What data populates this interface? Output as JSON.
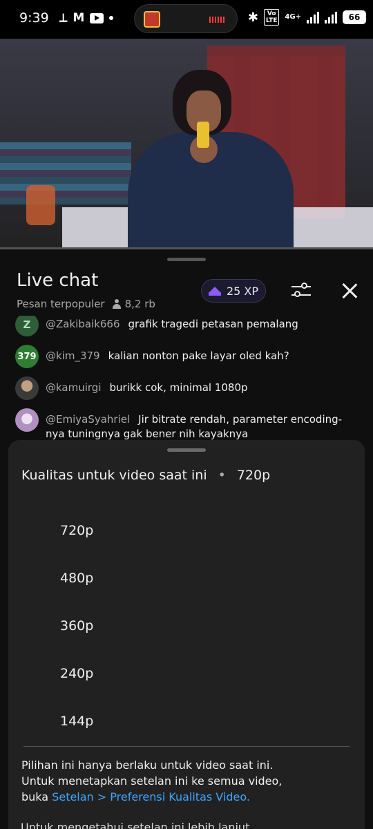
{
  "status_bar": {
    "time": "9:39",
    "left_icons": [
      "link-icon",
      "gmail-icon",
      "youtube-icon",
      "dot-icon"
    ],
    "volte": "Vo LTE",
    "network": "4G+",
    "battery": "66"
  },
  "chat": {
    "title": "Live chat",
    "filter": "Pesan terpopuler",
    "viewers": "8,2 rb",
    "xp": "25 XP",
    "messages": [
      {
        "avatar_text": "Z",
        "avatar_color": "#2e5d3a",
        "author": "@Zakibaik666",
        "text": "grafik tragedi petasan pemalang"
      },
      {
        "avatar_text": "379",
        "avatar_color": "#2e8b3a",
        "author": "@kim_379",
        "text": "kalian nonton pake layar oled kah?"
      },
      {
        "avatar_text": "",
        "avatar_color": "#6a6a6a",
        "author": "@kamuirgi",
        "text": "burikk cok, minimal 1080p"
      },
      {
        "avatar_text": "",
        "avatar_color": "#b8a0c8",
        "author": "@EmiyaSyahriel",
        "text": "Jir bitrate rendah, parameter encoding-nya tuningnya gak bener nih kayaknya"
      }
    ]
  },
  "quality_sheet": {
    "title": "Kualitas untuk video saat ini",
    "separator": "•",
    "current": "720p",
    "options": [
      "720p",
      "480p",
      "360p",
      "240p",
      "144p"
    ],
    "note_line1": "Pilihan ini hanya berlaku untuk video saat ini.",
    "note_line2": "Untuk menetapkan setelan ini ke semua video,",
    "note_prefix": "buka",
    "note_link": "Setelan > Preferensi Kualitas Video."
  },
  "below_text": "Untuk mengetahui setelan ini lebih lanjut"
}
